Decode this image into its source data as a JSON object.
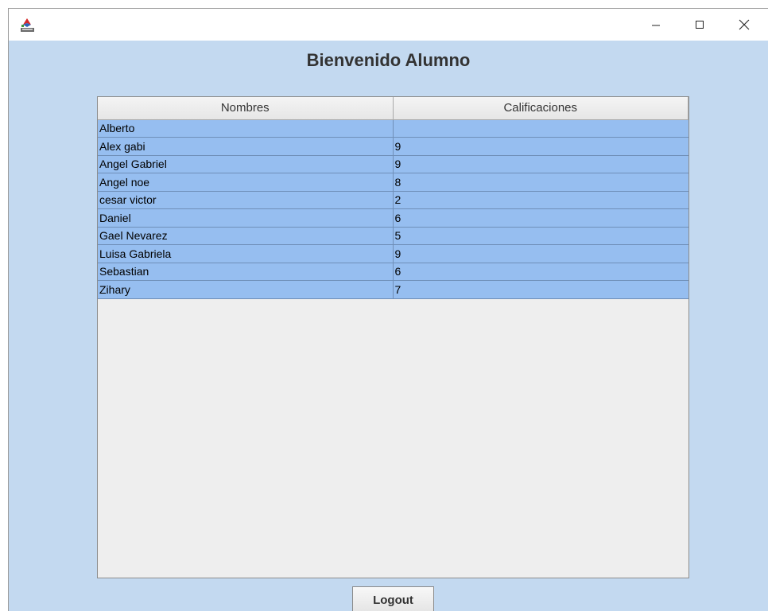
{
  "window": {
    "icons": {
      "app": "java-app-icon",
      "minimize": "minimize-icon",
      "maximize": "maximize-icon",
      "close": "close-icon"
    }
  },
  "main": {
    "heading": "Bienvenido Alumno"
  },
  "table": {
    "columns": [
      "Nombres",
      "Calificaciones"
    ],
    "rows": [
      [
        "Alberto",
        ""
      ],
      [
        "Alex gabi",
        "9"
      ],
      [
        "Angel Gabriel",
        "9"
      ],
      [
        "Angel noe",
        "8"
      ],
      [
        "cesar victor",
        "2"
      ],
      [
        "Daniel",
        "6"
      ],
      [
        "Gael Nevarez",
        "5"
      ],
      [
        "Luisa Gabriela",
        "9"
      ],
      [
        "Sebastian",
        "6"
      ],
      [
        "Zihary",
        "7"
      ]
    ]
  },
  "footer": {
    "logout_label": "Logout"
  },
  "colors": {
    "background": "#c3d9f0",
    "row_selected": "#96bef0",
    "table_area": "#eeeeee"
  }
}
